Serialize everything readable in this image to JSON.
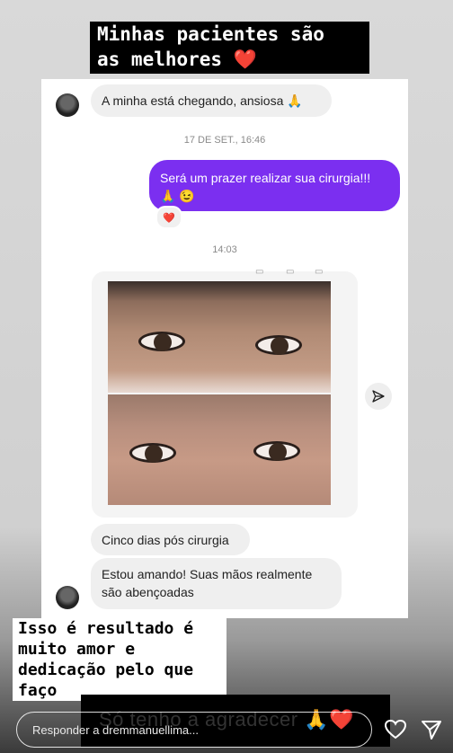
{
  "story": {
    "top_caption": "Minhas pacientes são\nas melhores ❤️",
    "bottom_caption": "Isso é resultado é\nmuito amor e\ndedicação pelo que\nfaço",
    "thanks_overlay": "Só tenho a agradecer 🙏❤️",
    "reply_placeholder": "Responder a dremmanuellima..."
  },
  "chat": {
    "msg1": "A minha está chegando, ansiosa 🙏",
    "stamp1": "17 DE SET., 16:46",
    "msg2": "Será um prazer realizar sua cirurgia!!!\n🙏 😉",
    "reaction": "❤️",
    "stamp2": "14:03",
    "msg3": "Cinco dias pós cirurgia",
    "msg4": "Estou amando! Suas mãos realmente\nsão abençoadas"
  },
  "colors": {
    "outgoing_bubble": "#7b2ff0",
    "incoming_bubble": "#efefef"
  },
  "icons": {
    "like": "heart-icon",
    "share": "send-icon",
    "image_share": "paper-plane-icon"
  }
}
